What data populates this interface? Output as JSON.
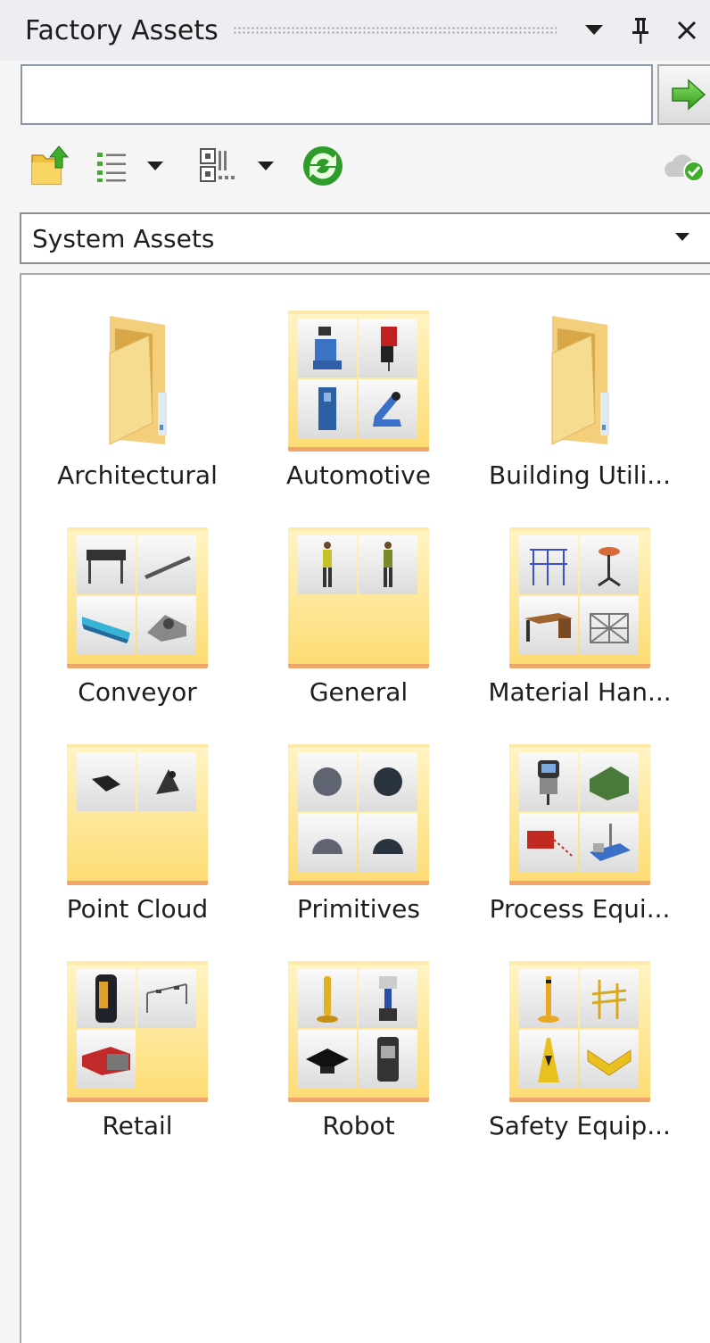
{
  "panel": {
    "title": "Factory Assets"
  },
  "search": {
    "value": "",
    "placeholder": ""
  },
  "library": {
    "selected": "System Assets"
  },
  "tiles": [
    {
      "label": "Architectural",
      "type": "folder"
    },
    {
      "label": "Automotive",
      "type": "preview"
    },
    {
      "label": "Building Utili...",
      "type": "folder"
    },
    {
      "label": "Conveyor",
      "type": "preview"
    },
    {
      "label": "General",
      "type": "preview"
    },
    {
      "label": "Material Han...",
      "type": "preview"
    },
    {
      "label": "Point Cloud",
      "type": "preview"
    },
    {
      "label": "Primitives",
      "type": "preview"
    },
    {
      "label": "Process Equi...",
      "type": "preview"
    },
    {
      "label": "Retail",
      "type": "preview"
    },
    {
      "label": "Robot",
      "type": "preview"
    },
    {
      "label": "Safety Equip...",
      "type": "preview"
    }
  ],
  "icons": {
    "dropdown": "chevron-down-icon",
    "pin": "pin-icon",
    "close": "close-icon",
    "go": "arrow-right-icon",
    "up": "folder-up-icon",
    "list": "list-view-icon",
    "thumbs": "thumbnail-size-icon",
    "refresh": "refresh-icon",
    "cloud": "cloud-sync-icon"
  },
  "colors": {
    "folder": "#f6d98a",
    "folder_accent": "#f0a66b",
    "go_green": "#3fae2a",
    "title_bg": "#eeeef2"
  }
}
